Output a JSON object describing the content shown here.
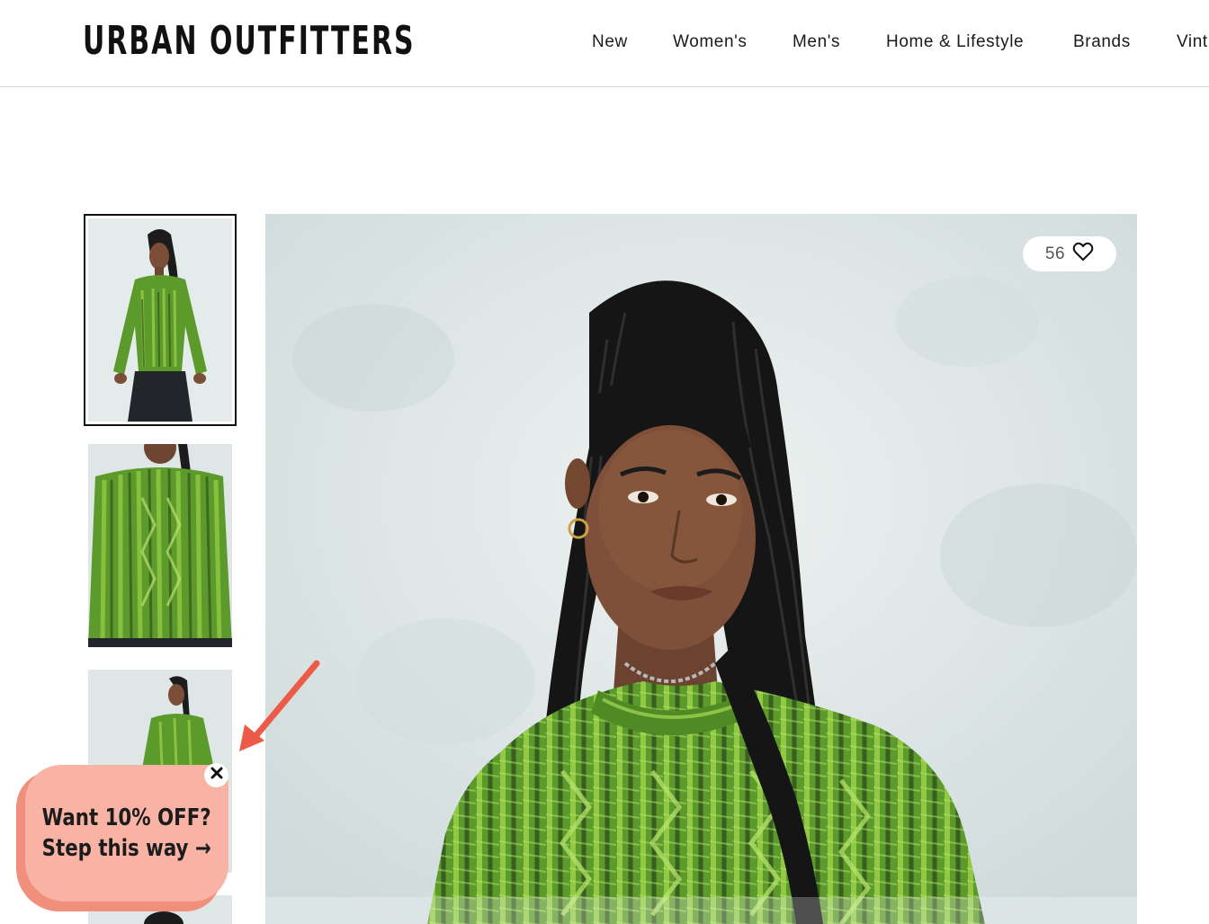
{
  "brand": {
    "logo_text": "URBAN OUTFITTERS"
  },
  "nav": {
    "items": [
      {
        "label": "New"
      },
      {
        "label": "Women's"
      },
      {
        "label": "Men's"
      },
      {
        "label": "Home & Lifestyle"
      },
      {
        "label": "Brands"
      },
      {
        "label": "Vint"
      }
    ]
  },
  "gallery": {
    "thumbnails": [
      {
        "alt": "model-full-body-front",
        "selected": true
      },
      {
        "alt": "sweater-closeup",
        "selected": false
      },
      {
        "alt": "model-full-body-small",
        "selected": false
      },
      {
        "alt": "model-partial",
        "selected": false
      }
    ],
    "main_image": "model-wearing-green-cable-knit-sweater",
    "like_count": "56",
    "like_icon": "heart-outline-icon"
  },
  "promo": {
    "line1": "Want 10% OFF?",
    "line2": "Step this way →",
    "close_icon": "close-icon"
  },
  "annotation": {
    "icon": "arrow-pointer-icon",
    "color": "#ee5a48"
  },
  "colors": {
    "sweater_green": "#5c9a2c",
    "sweater_light": "#9fd34a",
    "sweater_dark": "#2c4a1c",
    "backdrop": "#dfe6e6",
    "promo_pink": "#f9b3a5",
    "promo_shadow": "#f08f7c",
    "header_border": "#d6d6d6"
  }
}
